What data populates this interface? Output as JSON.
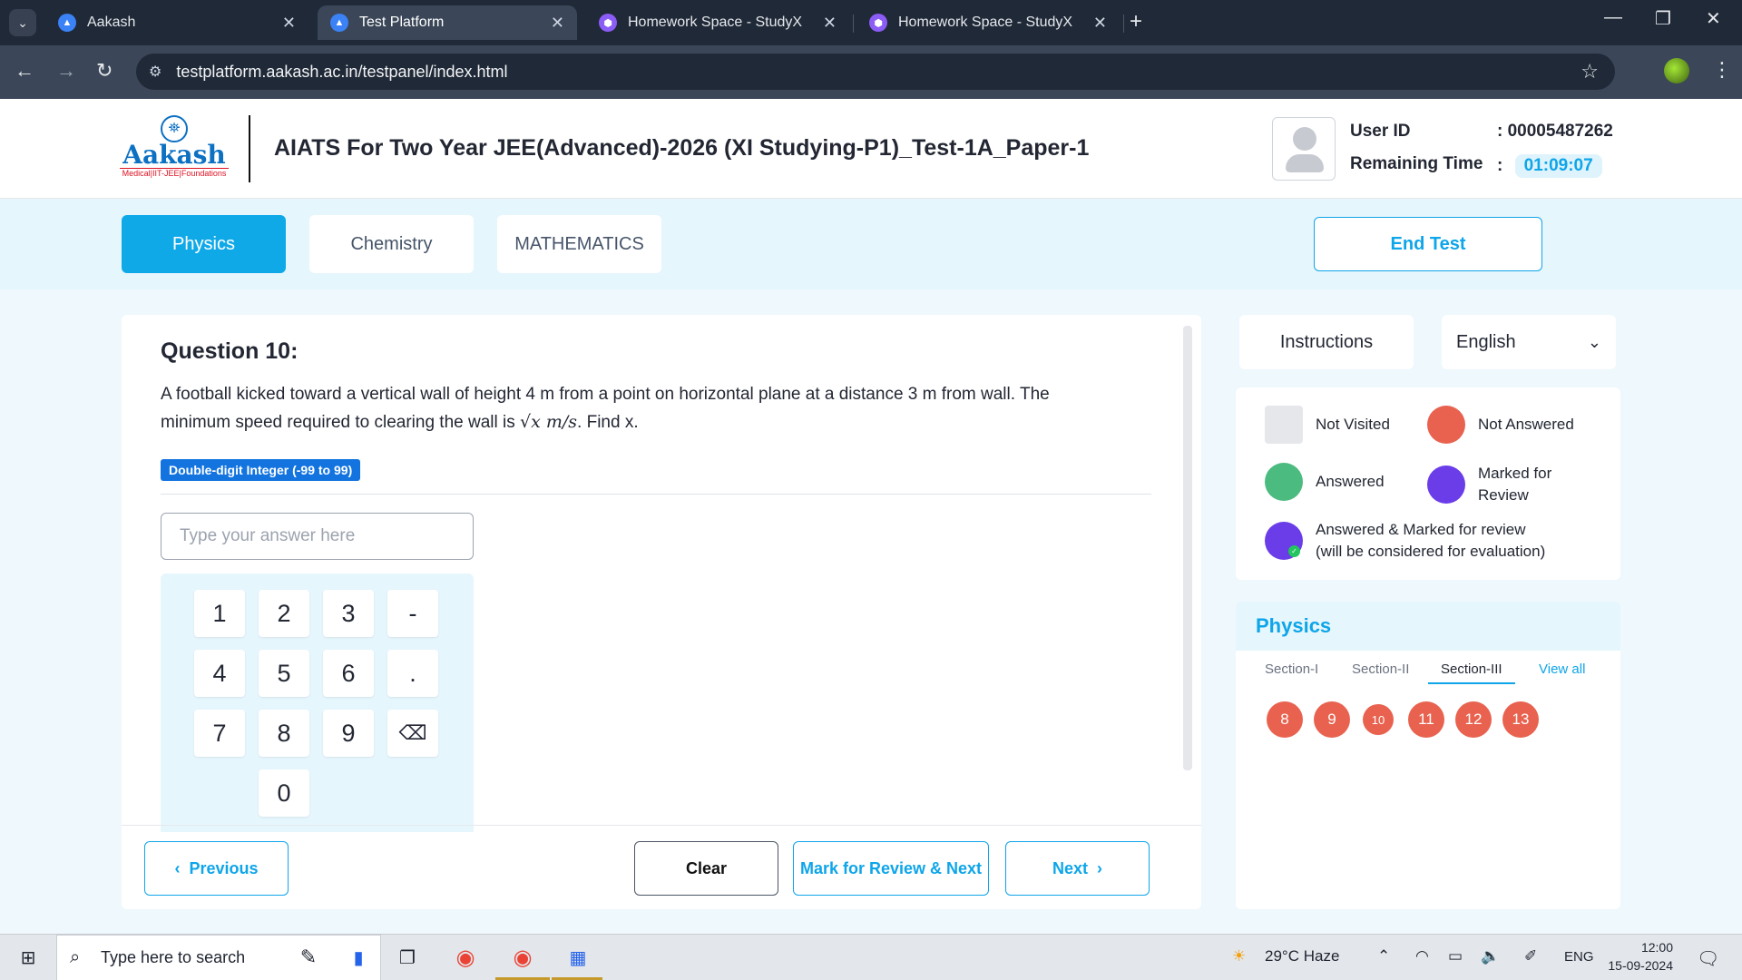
{
  "browser": {
    "tabs": [
      {
        "title": "Aakash",
        "icon": "aakash-icon",
        "active": false
      },
      {
        "title": "Test Platform",
        "icon": "aakash-icon",
        "active": true
      },
      {
        "title": "Homework Space - StudyX",
        "icon": "studyx-icon",
        "active": false
      },
      {
        "title": "Homework Space - StudyX",
        "icon": "studyx-icon",
        "active": false
      }
    ],
    "url": "testplatform.aakash.ac.in/testpanel/index.html"
  },
  "header": {
    "logo_text": "Aakash",
    "logo_sub": "Medical|IIT-JEE|Foundations",
    "test_title": "AIATS For Two Year JEE(Advanced)-2026 (XI Studying-P1)_Test-1A_Paper-1",
    "user_id_label": "User ID",
    "user_id_value": ": 00005487262",
    "remaining_label": "Remaining Time",
    "remaining_sep": ":",
    "remaining_value": "01:09:07"
  },
  "subjects": {
    "tabs": [
      {
        "label": "Physics",
        "active": true
      },
      {
        "label": "Chemistry",
        "active": false
      },
      {
        "label": "MATHEMATICS",
        "active": false
      }
    ],
    "end_test": "End Test"
  },
  "question": {
    "title": "Question 10:",
    "text_part1": "A football kicked toward a vertical wall of height 4 m from a point on horizontal plane at a distance 3 m from wall. The minimum speed required to clearing the wall is ",
    "math": "√x m/s",
    "text_part2": ". Find x.",
    "type_badge": "Double-digit Integer (-99 to 99)",
    "answer_placeholder": "Type your answer here",
    "keypad": [
      "1",
      "2",
      "3",
      "-",
      "4",
      "5",
      "6",
      ".",
      "7",
      "8",
      "9",
      "⌫",
      "0"
    ]
  },
  "footer": {
    "previous": "Previous",
    "clear": "Clear",
    "mark_review": "Mark for Review & Next",
    "next": "Next"
  },
  "side": {
    "instructions": "Instructions",
    "language": "English",
    "legend": {
      "not_visited": "Not Visited",
      "not_answered": "Not Answered",
      "answered": "Answered",
      "marked": "Marked for Review",
      "answered_marked_1": "Answered & Marked for review",
      "answered_marked_2": "(will be considered for evaluation)"
    },
    "palette": {
      "subject": "Physics",
      "sections": [
        "Section-I",
        "Section-II",
        "Section-III"
      ],
      "active_section": "Section-III",
      "view_all": "View all",
      "questions": [
        "8",
        "9",
        "10",
        "11",
        "12",
        "13"
      ]
    }
  },
  "taskbar": {
    "search_placeholder": "Type here to search",
    "weather": "29°C  Haze",
    "lang": "ENG",
    "time": "12:00",
    "date": "15-09-2024"
  },
  "colors": {
    "accent": "#10a9e8",
    "not_answered": "#e8624f",
    "answered": "#4cbb7f",
    "marked": "#6a3de8",
    "not_visited": "#e5e7eb"
  }
}
